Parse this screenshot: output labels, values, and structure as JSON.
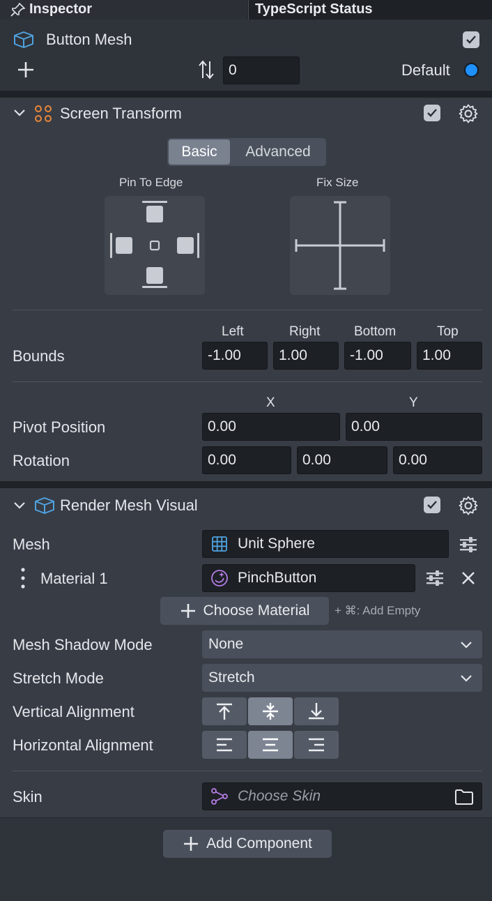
{
  "tabs": {
    "inspector": "Inspector",
    "typescript_status": "TypeScript Status"
  },
  "object": {
    "name": "Button Mesh",
    "layer_value": "0",
    "layer_label": "Default",
    "layer_color": "#1e90ff"
  },
  "screen_transform": {
    "title": "Screen Transform",
    "mode_basic": "Basic",
    "mode_advanced": "Advanced",
    "pin_to_edge": "Pin To Edge",
    "fix_size": "Fix Size",
    "bounds_label": "Bounds",
    "bounds_headers": [
      "Left",
      "Right",
      "Bottom",
      "Top"
    ],
    "bounds_values": [
      "-1.00",
      "1.00",
      "-1.00",
      "1.00"
    ],
    "pivot_label": "Pivot Position",
    "pivot_headers": [
      "X",
      "Y"
    ],
    "pivot_values": [
      "0.00",
      "0.00"
    ],
    "rotation_label": "Rotation",
    "rotation_values": [
      "0.00",
      "0.00",
      "0.00"
    ]
  },
  "render_mesh_visual": {
    "title": "Render Mesh Visual",
    "mesh_label": "Mesh",
    "mesh_value": "Unit Sphere",
    "material_label": "Material 1",
    "material_value": "PinchButton",
    "choose_material": "Choose Material",
    "add_empty_hint": "+ ⌘: Add Empty",
    "shadow_label": "Mesh Shadow Mode",
    "shadow_value": "None",
    "stretch_label": "Stretch Mode",
    "stretch_value": "Stretch",
    "vertical_label": "Vertical Alignment",
    "horizontal_label": "Horizontal Alignment",
    "skin_label": "Skin",
    "skin_placeholder": "Choose Skin"
  },
  "footer": {
    "add_component": "Add Component"
  },
  "colors": {
    "accent_orange": "#e8873a",
    "accent_blue": "#4fa3e0",
    "accent_purple": "#b77ee6"
  }
}
